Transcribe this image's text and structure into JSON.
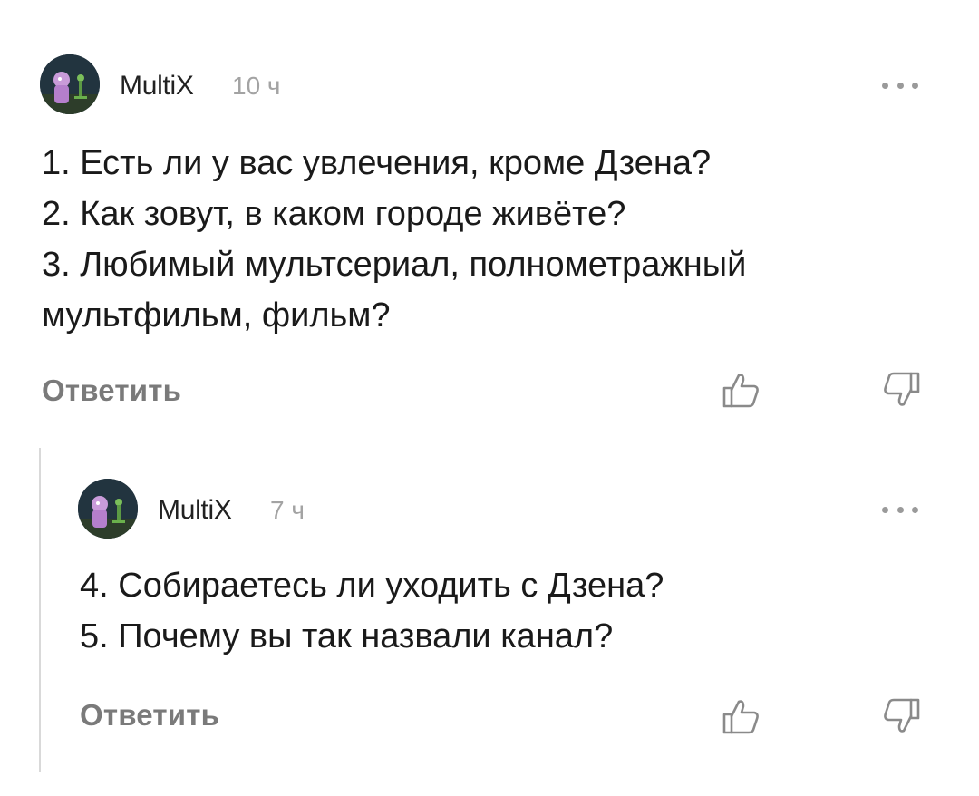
{
  "comments": [
    {
      "author": "MultiX",
      "time": "10 ч",
      "lines": [
        "1. Есть ли у вас увлечения, кроме Дзена?",
        "2. Как зовут, в каком городе живёте?",
        "3. Любимый мультсериал, полнометражный",
        "мультфильм, фильм?"
      ],
      "reply_label": "Ответить",
      "icons": {
        "more": "more-icon",
        "like": "thumbs-up-icon",
        "dislike": "thumbs-down-icon"
      }
    },
    {
      "author": "MultiX",
      "time": "7 ч",
      "lines": [
        "4. Собираетесь ли уходить с Дзена?",
        "5. Почему вы так назвали канал?"
      ],
      "reply_label": "Ответить",
      "icons": {
        "more": "more-icon",
        "like": "thumbs-up-icon",
        "dislike": "thumbs-down-icon"
      }
    }
  ],
  "colors": {
    "text": "#1a1a1a",
    "meta": "#a3a3a3",
    "action": "#7a7a7a",
    "thread_line": "#d9d9d9"
  }
}
